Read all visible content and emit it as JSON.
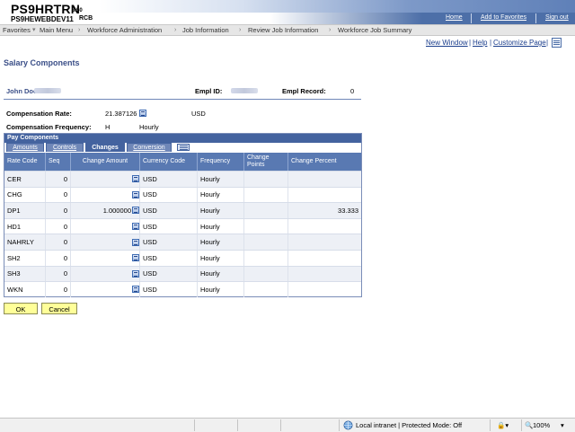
{
  "header": {
    "title1": "PS9HRTRN",
    "version": "8.50",
    "title2": "PS9HEWEBDEV11",
    "rcb": "RCB",
    "links": [
      "Home",
      "Add to Favorites",
      "Sign out"
    ]
  },
  "nav": {
    "items": [
      "Favorites",
      "Main Menu",
      "Workforce Administration",
      "Job Information",
      "Review Job Information",
      "Workforce Job Summary"
    ]
  },
  "tools": {
    "links": [
      "New Window",
      "Help",
      "Customize Page"
    ],
    "icon": "grid-icon"
  },
  "page": {
    "title": "Salary Components"
  },
  "employee": {
    "name": "John Doe",
    "empl_id_label": "Empl ID:",
    "empl_record_label": "Empl Record:",
    "empl_record_value": "0"
  },
  "compensation": {
    "rate_label": "Compensation Rate:",
    "rate_value": "21.387126",
    "rate_currency": "USD",
    "freq_label": "Compensation Frequency:",
    "freq_code": "H",
    "freq_desc": "Hourly"
  },
  "grid": {
    "title": "Pay Components",
    "tabs": [
      "Amounts",
      "Controls",
      "Changes",
      "Conversion"
    ],
    "active_tab": "Changes",
    "columns": [
      "Rate Code",
      "Seq",
      "Change Amount",
      "Currency Code",
      "Frequency",
      "Change Points",
      "Change Percent"
    ],
    "rows": [
      {
        "rate_code": "CER",
        "seq": "0",
        "change_amount": "",
        "currency": "USD",
        "frequency": "Hourly",
        "change_points": "",
        "change_percent": ""
      },
      {
        "rate_code": "CHG",
        "seq": "0",
        "change_amount": "",
        "currency": "USD",
        "frequency": "Hourly",
        "change_points": "",
        "change_percent": ""
      },
      {
        "rate_code": "DP1",
        "seq": "0",
        "change_amount": "1.000000",
        "currency": "USD",
        "frequency": "Hourly",
        "change_points": "",
        "change_percent": "33.333"
      },
      {
        "rate_code": "HD1",
        "seq": "0",
        "change_amount": "",
        "currency": "USD",
        "frequency": "Hourly",
        "change_points": "",
        "change_percent": ""
      },
      {
        "rate_code": "NAHRLY",
        "seq": "0",
        "change_amount": "",
        "currency": "USD",
        "frequency": "Hourly",
        "change_points": "",
        "change_percent": ""
      },
      {
        "rate_code": "SH2",
        "seq": "0",
        "change_amount": "",
        "currency": "USD",
        "frequency": "Hourly",
        "change_points": "",
        "change_percent": ""
      },
      {
        "rate_code": "SH3",
        "seq": "0",
        "change_amount": "",
        "currency": "USD",
        "frequency": "Hourly",
        "change_points": "",
        "change_percent": ""
      },
      {
        "rate_code": "WKN",
        "seq": "0",
        "change_amount": "",
        "currency": "USD",
        "frequency": "Hourly",
        "change_points": "",
        "change_percent": ""
      }
    ]
  },
  "buttons": {
    "ok": "OK",
    "cancel": "Cancel"
  },
  "statusbar": {
    "zone": "Local intranet | Protected Mode: Off",
    "zoom": "100%"
  },
  "colors": {
    "accent": "#44639f",
    "header_bar": "#5979b2",
    "title": "#3b4f88",
    "button_bg": "#ffff99"
  }
}
